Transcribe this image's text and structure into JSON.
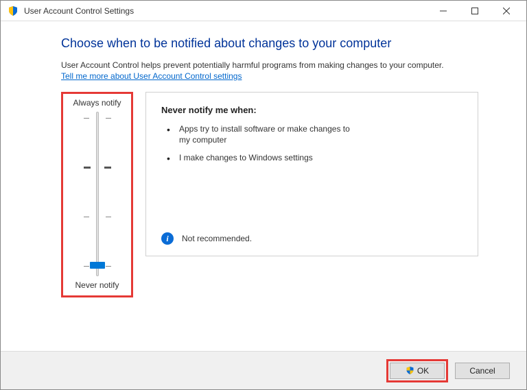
{
  "window": {
    "title": "User Account Control Settings"
  },
  "content": {
    "heading": "Choose when to be notified about changes to your computer",
    "description": "User Account Control helps prevent potentially harmful programs from making changes to your computer.",
    "link": "Tell me more about User Account Control settings"
  },
  "slider": {
    "top_label": "Always notify",
    "bottom_label": "Never notify",
    "levels": 4,
    "current_level": 0
  },
  "panel": {
    "heading": "Never notify me when:",
    "bullets": [
      "Apps try to install software or make changes to my computer",
      "I make changes to Windows settings"
    ],
    "recommendation": "Not recommended."
  },
  "footer": {
    "ok": "OK",
    "cancel": "Cancel"
  }
}
